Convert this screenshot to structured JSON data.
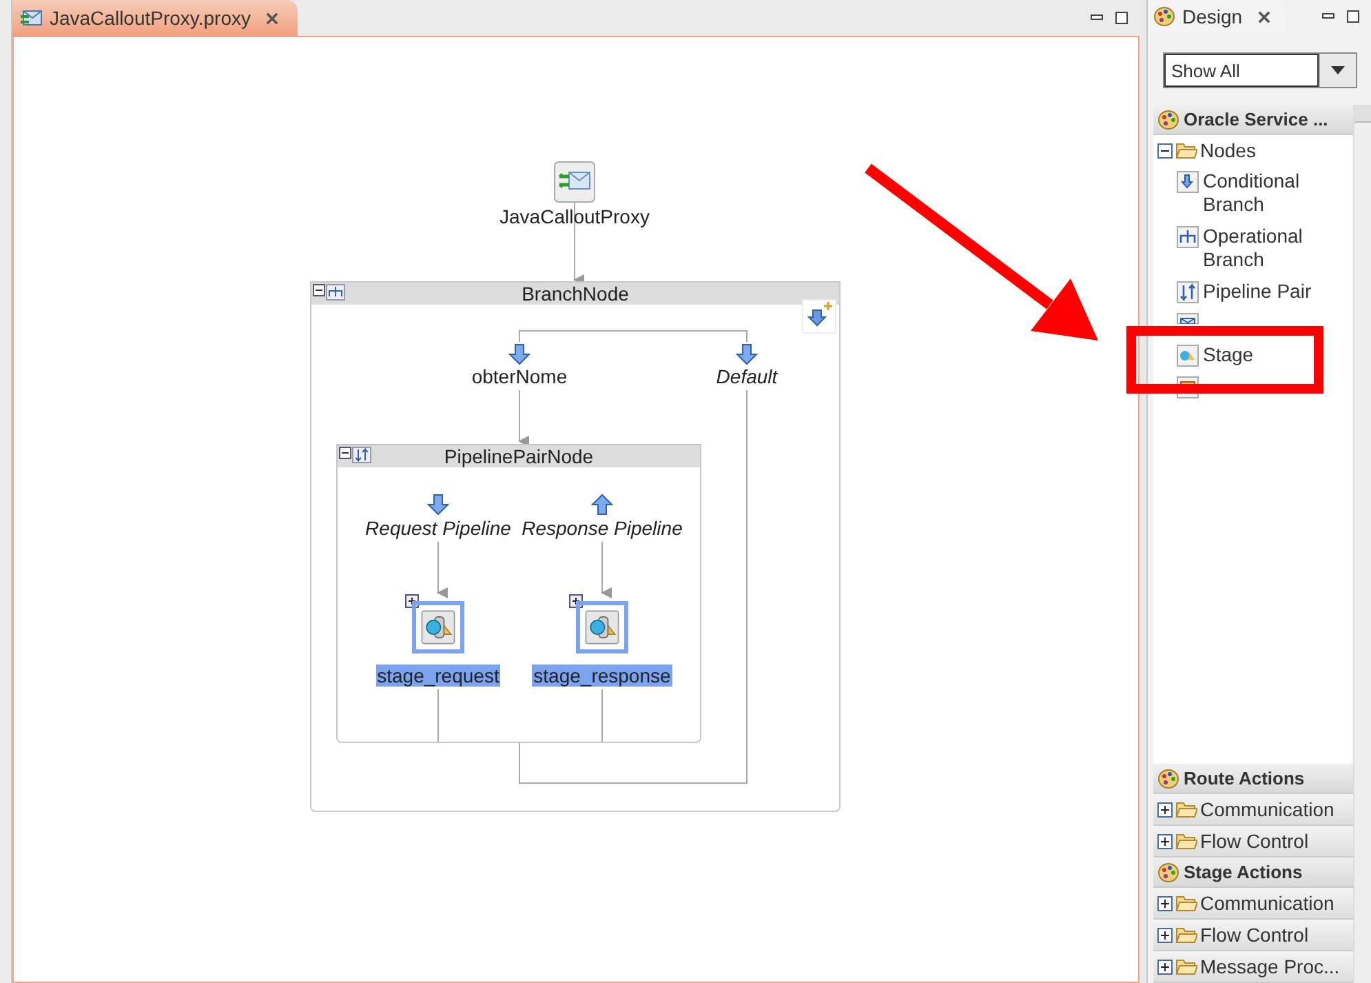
{
  "editor_tab": {
    "title": "JavaCalloutProxy.proxy",
    "selected": true
  },
  "diagram": {
    "proxy": {
      "label": "JavaCalloutProxy"
    },
    "branch_node": {
      "title": "BranchNode",
      "branches": [
        {
          "label": "obterNome",
          "kind": "case"
        },
        {
          "label": "Default",
          "kind": "default"
        }
      ]
    },
    "pipeline_pair_node": {
      "title": "PipelinePairNode",
      "pipelines": [
        {
          "label": "Request Pipeline",
          "kind": "request",
          "stage": {
            "label": "stage_request",
            "selected": true
          }
        },
        {
          "label": "Response Pipeline",
          "kind": "response",
          "stage": {
            "label": "stage_response",
            "selected": true
          }
        }
      ]
    }
  },
  "panel_tab": {
    "title": "Design",
    "selected": true
  },
  "palette": {
    "filter": "Show All",
    "sections": [
      {
        "title": "Oracle Service ...",
        "folders": [
          {
            "label": "Nodes",
            "expanded": true,
            "items": [
              {
                "label": "Conditional Branch",
                "kind": "conditional"
              },
              {
                "label": "Operational Branch",
                "kind": "operational"
              },
              {
                "label": "Pipeline Pair",
                "kind": "pipeline"
              },
              {
                "kind": "route"
              },
              {
                "label": "Stage",
                "kind": "stage"
              },
              {
                "kind": "error"
              }
            ]
          }
        ]
      },
      {
        "title": "Route Actions",
        "folders": [
          {
            "label": "Communication",
            "expanded": false
          },
          {
            "label": "Flow Control",
            "expanded": false
          }
        ]
      },
      {
        "title": "Stage Actions",
        "folders": [
          {
            "label": "Communication",
            "expanded": false
          },
          {
            "label": "Flow Control",
            "expanded": false
          },
          {
            "label": "Message Proc...",
            "expanded": false
          }
        ]
      }
    ]
  }
}
